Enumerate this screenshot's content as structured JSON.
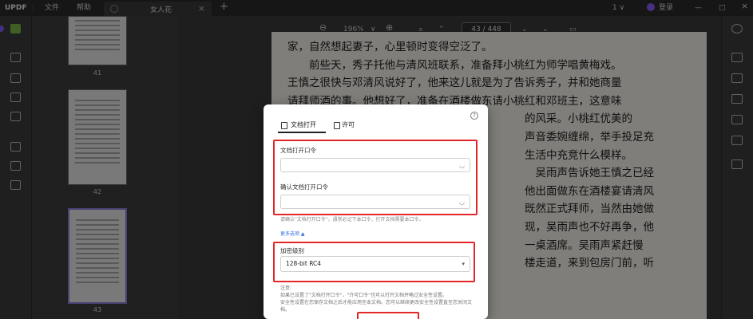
{
  "titlebar": {
    "logo": "UPDF",
    "menu_file": "文件",
    "menu_help": "帮助",
    "tab_title": "女人花",
    "tab_close": "×",
    "new_tab": "+",
    "version": "1 ∨",
    "login": "登录",
    "minimize": "—",
    "maximize": "□",
    "close": "×"
  },
  "viewer": {
    "zoom_out": "⊖",
    "zoom_level": "196%",
    "zoom_dropdown": "∨",
    "zoom_in": "⊕",
    "first_page": "⌅",
    "prev_page": "⌃",
    "page_indicator": "43 / 448",
    "next_page": "⌄",
    "last_page": "⌄",
    "comment": "▭"
  },
  "thumbnails": [
    {
      "label": "41"
    },
    {
      "label": "42"
    },
    {
      "label": "43"
    }
  ],
  "document": {
    "lines": [
      "家，自然想起妻子，心里顿时变得空泛了。",
      "　　前些天，秀子托他与清风班联系，准备拜小桃红为师学唱黄梅戏。",
      "王慎之很快与邓清风说好了，他来这儿就是为了告诉秀子，并和她商量",
      "请拜师酒的事。他想好了，准备在酒楼做东请小桃红和邓班主，这意味",
      "　　　　　　　　　　　　　　　　　　　　　　的风采。小桃红优美的",
      "　　　　　　　　　　　　　　　　　　　　　　声音委婉缠绵，举手投足充",
      "　　　　　　　　　　　　　　　　　　　　　　生活中充竞什么模样。",
      "　　　　　　　　　　　　　　　　　　　　　　　吴雨声告诉她王慎之已经",
      "　　　　　　　　　　　　　　　　　　　　　　他出面做东在酒楼宴请清风",
      "　　　　　　　　　　　　　　　　　　　　　　既然正式拜师，当然由她做",
      "　　　　　　　　　　　　　　　　　　　　　　现，吴雨声也不好再争，他",
      "",
      "　　　　　　　　　　　　　　　　　　　　　　一桌酒席。吴雨声紧赶慢",
      "　　　　　　　　　　　　　　　　　　　　　　楼走道，来到包房门前，听"
    ]
  },
  "dialog": {
    "tab_open_password": "文档打开",
    "tab_permission": "许可",
    "help": "?",
    "label_open_password": "文档打开口令",
    "open_password_value": "",
    "label_confirm_password": "确认文档打开口令",
    "confirm_password_value": "",
    "eye_icon": "◡",
    "hint": "请确认\"文档打开口令\"，通常必记下本口令，打开文档需要本口令。",
    "more_options": "更多选项 ▲",
    "label_encryption": "加密级别",
    "encryption_value": "128-bit RC4",
    "select_arrow": "▾",
    "note_title": "注意:",
    "note_line1": "如果已设置了\"文档打开口令\"，\"许可口令\"也可以打开文档并略过安全性设置。",
    "note_line2": "安全性设置在您保存文档之后才能应用至本文档。您可以继续更改安全性设置直至您关闭文",
    "note_line3": "档。"
  },
  "colors": {
    "highlight_box": "#e3262a",
    "accent_purple": "#8b5cf6",
    "active_tool": "#7ab648"
  }
}
